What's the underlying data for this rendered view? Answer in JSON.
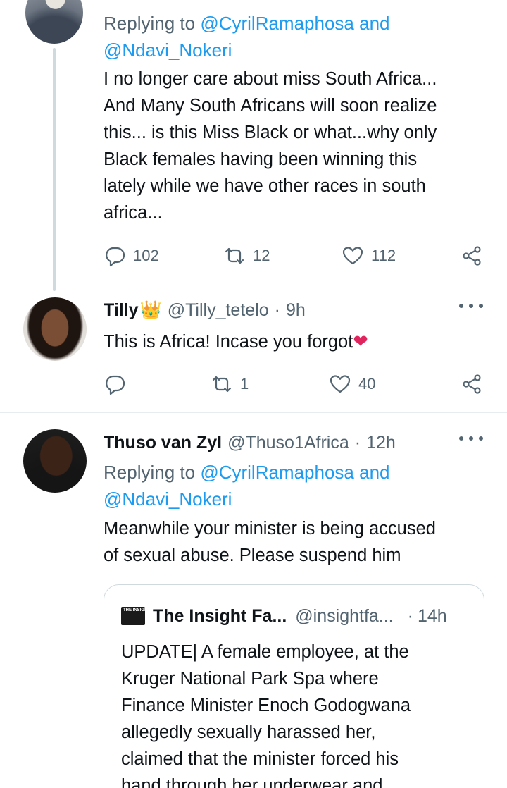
{
  "tweets": [
    {
      "replying_prefix": "Replying to",
      "replying_mention_1": "@CyrilRamaphosa",
      "replying_and": "and",
      "replying_mention_2": "@Ndavi_Nokeri",
      "lines": [
        "I no longer care about miss South Africa...",
        "And Many South Africans will soon realize",
        "this... is this Miss Black or what...why only",
        "Black females  having been winning  this",
        "lately while we have other races in south",
        "africa..."
      ],
      "replies": "102",
      "retweets": "12",
      "likes": "112"
    },
    {
      "name": "Tilly",
      "name_emoji": "👑",
      "handle": "@Tilly_tetelo",
      "separator": "·",
      "time": "9h",
      "text": "This is Africa! Incase you forgot",
      "text_emoji": "❤",
      "replies": "",
      "retweets": "1",
      "likes": "40"
    },
    {
      "name": "Thuso van Zyl",
      "handle": "@Thuso1Africa",
      "separator": "·",
      "time": "12h",
      "replying_prefix": "Replying to",
      "replying_mention_1": "@CyrilRamaphosa",
      "replying_and": "and",
      "replying_mention_2": "@Ndavi_Nokeri",
      "lines": [
        "Meanwhile your minister is being accused",
        "of sexual abuse. Please suspend him"
      ],
      "quote": {
        "logo_text": "THE INSIGHT FACTOR",
        "name": "The Insight Fa...",
        "handle": "@insightfa...",
        "separator": "·",
        "time": "14h",
        "lines": [
          "UPDATE| A female employee, at the",
          "Kruger National Park Spa where",
          "Finance Minister Enoch Godogwana",
          "allegedly sexually harassed her,",
          "claimed that the minister forced his",
          "hand through her underwear and"
        ]
      }
    }
  ],
  "icons": {
    "reply": "reply-icon",
    "retweet": "retweet-icon",
    "like": "heart-icon",
    "share": "share-icon",
    "more": "more-options-icon"
  },
  "colors": {
    "link": "#1d9bf0",
    "secondary_text": "#536471",
    "heart_emoji": "#e0245e"
  }
}
